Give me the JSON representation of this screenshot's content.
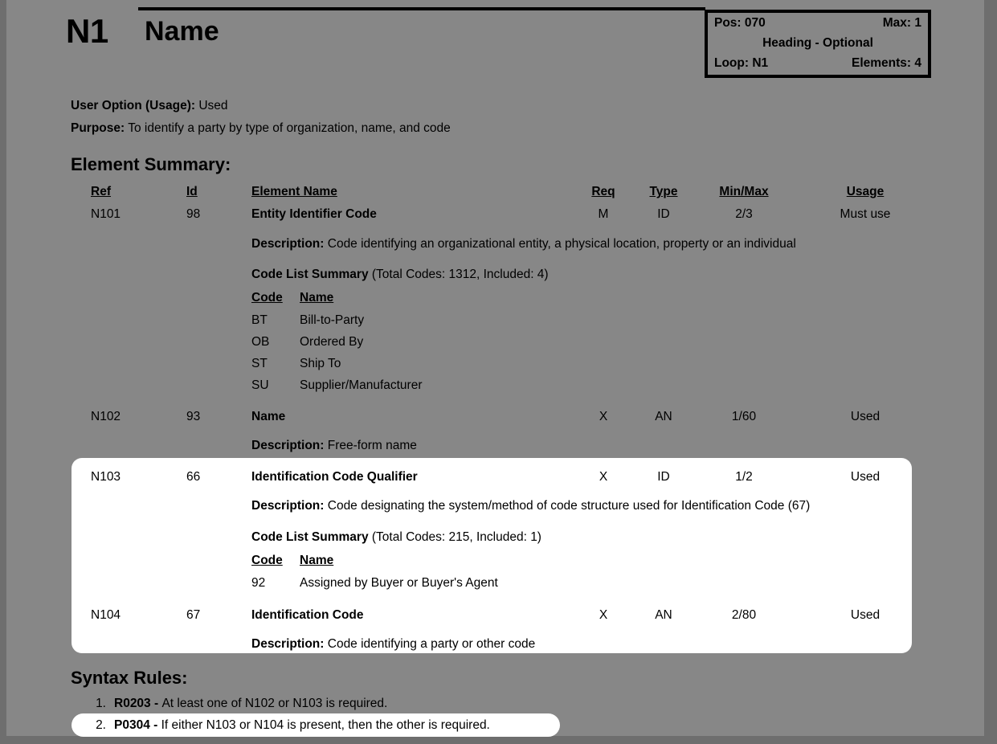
{
  "header": {
    "segment_code": "N1",
    "segment_name": "Name",
    "info": {
      "pos_label": "Pos: 070",
      "max_label": "Max: 1",
      "area_label": "Heading - Optional",
      "loop_label": "Loop: N1",
      "elements_label": "Elements: 4"
    }
  },
  "meta": {
    "user_option_label": "User Option (Usage):",
    "user_option_value": "Used",
    "purpose_label": "Purpose:",
    "purpose_value": "To identify a party by type of organization, name, and code"
  },
  "element_summary": {
    "title": "Element Summary:",
    "columns": {
      "ref": "Ref",
      "id": "Id",
      "name": "Element Name",
      "req": "Req",
      "type": "Type",
      "minmax": "Min/Max",
      "usage": "Usage"
    },
    "code_columns": {
      "code": "Code",
      "name": "Name"
    },
    "description_label": "Description:",
    "code_list_label": "Code List Summary",
    "elements": [
      {
        "ref": "N101",
        "id": "98",
        "name": "Entity Identifier Code",
        "req": "M",
        "type": "ID",
        "minmax": "2/3",
        "usage": "Must use",
        "description": "Code identifying an organizational entity, a physical location, property or an individual",
        "code_list_counts": "(Total Codes: 1312, Included: 4)",
        "codes": [
          {
            "code": "BT",
            "name": "Bill-to-Party"
          },
          {
            "code": "OB",
            "name": "Ordered By"
          },
          {
            "code": "ST",
            "name": "Ship To"
          },
          {
            "code": "SU",
            "name": "Supplier/Manufacturer"
          }
        ]
      },
      {
        "ref": "N102",
        "id": "93",
        "name": "Name",
        "req": "X",
        "type": "AN",
        "minmax": "1/60",
        "usage": "Used",
        "description": "Free-form name",
        "code_list_counts": "",
        "codes": []
      },
      {
        "ref": "N103",
        "id": "66",
        "name": "Identification Code Qualifier",
        "req": "X",
        "type": "ID",
        "minmax": "1/2",
        "usage": "Used",
        "description": "Code designating the system/method of code structure used for Identification Code (67)",
        "code_list_counts": "(Total Codes: 215, Included: 1)",
        "codes": [
          {
            "code": "92",
            "name": "Assigned by Buyer or Buyer's Agent"
          }
        ]
      },
      {
        "ref": "N104",
        "id": "67",
        "name": "Identification Code",
        "req": "X",
        "type": "AN",
        "minmax": "2/80",
        "usage": "Used",
        "description": "Code identifying a party or other code",
        "code_list_counts": "",
        "codes": []
      }
    ]
  },
  "syntax_rules": {
    "title": "Syntax Rules:",
    "rules": [
      {
        "num": "1.",
        "code": "R0203",
        "sep": " - ",
        "text": "At least one of N102 or N103 is required."
      },
      {
        "num": "2.",
        "code": "P0304",
        "sep": " - ",
        "text": "If either N103 or N104 is present, then the other is required."
      }
    ]
  },
  "colors": {
    "page_background": "#878787",
    "chrome": "#6e6e6e",
    "highlight": "#ffffff",
    "text": "#000000"
  }
}
